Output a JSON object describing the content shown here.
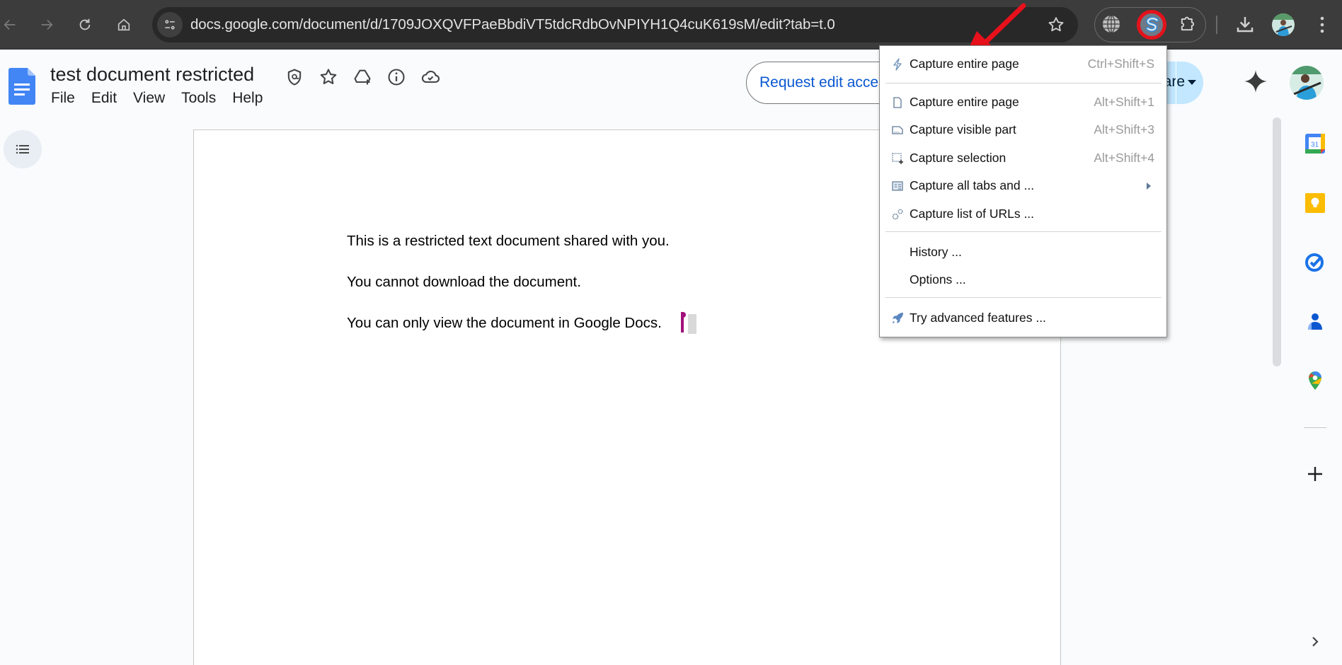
{
  "browser": {
    "url": "docs.google.com/document/d/1709JOXQVFPaeBbdiVT5tdcRdbOvNPIYH1Q4cuK619sM/edit?tab=t.0",
    "nav": [
      "back-icon",
      "forward-icon",
      "reload-icon",
      "home-icon"
    ],
    "extensions": [
      "globe-icon",
      "screenshot-extension-icon",
      "puzzle-icon"
    ],
    "highlight_color": "#e4121b"
  },
  "docs": {
    "title": "test document restricted",
    "title_icons": [
      "shield-icon",
      "star-icon",
      "drive-add-icon",
      "info-icon",
      "cloud-done-icon"
    ],
    "menu": [
      "File",
      "Edit",
      "View",
      "Tools",
      "Help"
    ],
    "request_edit_label": "Request edit access",
    "share_label": "Share",
    "accent_color": "#0b57d0",
    "share_bg": "#c2e7ff"
  },
  "document": {
    "paragraphs": [
      "This is a restricted text document shared with you.",
      "You cannot download the document.",
      "You can only view the document in Google Docs."
    ]
  },
  "side_panel": {
    "apps": [
      "calendar-icon",
      "keep-icon",
      "tasks-icon",
      "contacts-icon",
      "maps-icon"
    ],
    "calendar_day": "31"
  },
  "extension_menu": {
    "items": [
      {
        "label": "Capture entire page",
        "shortcut": "Ctrl+Shift+S",
        "icon": "lightning-icon"
      },
      {
        "label": "Capture entire page",
        "shortcut": "Alt+Shift+1",
        "icon": "page-icon"
      },
      {
        "label": "Capture visible part",
        "shortcut": "Alt+Shift+3",
        "icon": "visible-part-icon"
      },
      {
        "label": "Capture selection",
        "shortcut": "Alt+Shift+4",
        "icon": "selection-icon"
      },
      {
        "label": "Capture all tabs and ...",
        "shortcut": "",
        "icon": "tabs-icon",
        "submenu": true
      },
      {
        "label": "Capture list of URLs ...",
        "shortcut": "",
        "icon": "gears-icon"
      },
      {
        "label": "History ...",
        "shortcut": ""
      },
      {
        "label": "Options ...",
        "shortcut": ""
      },
      {
        "label": "Try advanced features ...",
        "shortcut": "",
        "icon": "rocket-icon"
      }
    ]
  }
}
